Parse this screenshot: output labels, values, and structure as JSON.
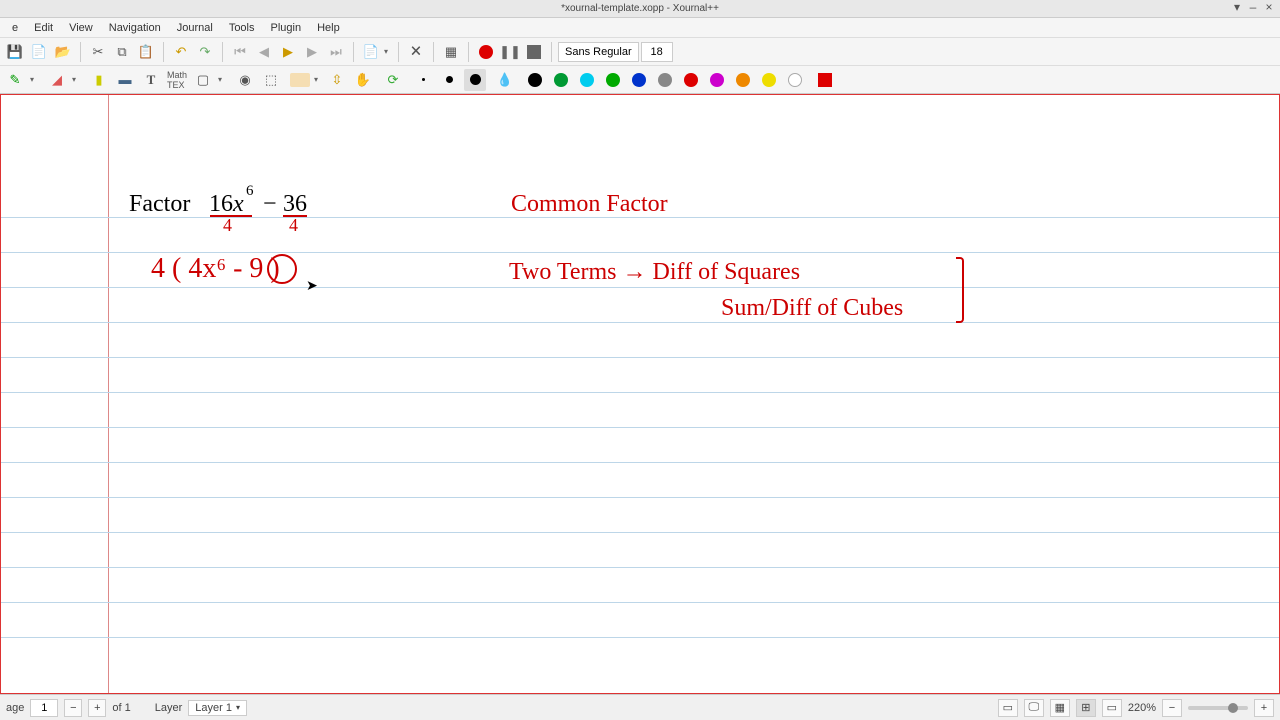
{
  "window": {
    "title": "*xournal-template.xopp - Xournal++"
  },
  "menu": {
    "items": [
      "e",
      "Edit",
      "View",
      "Navigation",
      "Journal",
      "Tools",
      "Plugin",
      "Help"
    ]
  },
  "toolbar": {
    "font": "Sans Regular",
    "size": "18"
  },
  "status": {
    "page_label": "age",
    "page_current": "1",
    "page_of": "of 1",
    "layer_label": "Layer",
    "layer_value": "Layer 1",
    "zoom": "220%"
  },
  "content": {
    "factor_label": "Factor",
    "expr_16": "16",
    "expr_x": "x",
    "expr_exp": "6",
    "expr_minus": "−",
    "expr_36": "36",
    "div_4a": "4",
    "div_4b": "4",
    "line2": "4 ( 4x⁶ - 9  )",
    "circled": "9",
    "right1": "Common Factor",
    "right2": "Two  Terms   →   Diff  of  Squares",
    "right3": "Sum/Diff  of  Cubes"
  },
  "colors": {
    "palette": [
      "#000000",
      "#009933",
      "#00ccee",
      "#00aa00",
      "#0033cc",
      "#888888",
      "#dd0000",
      "#cc00cc",
      "#ee8800",
      "#eedd00"
    ]
  }
}
